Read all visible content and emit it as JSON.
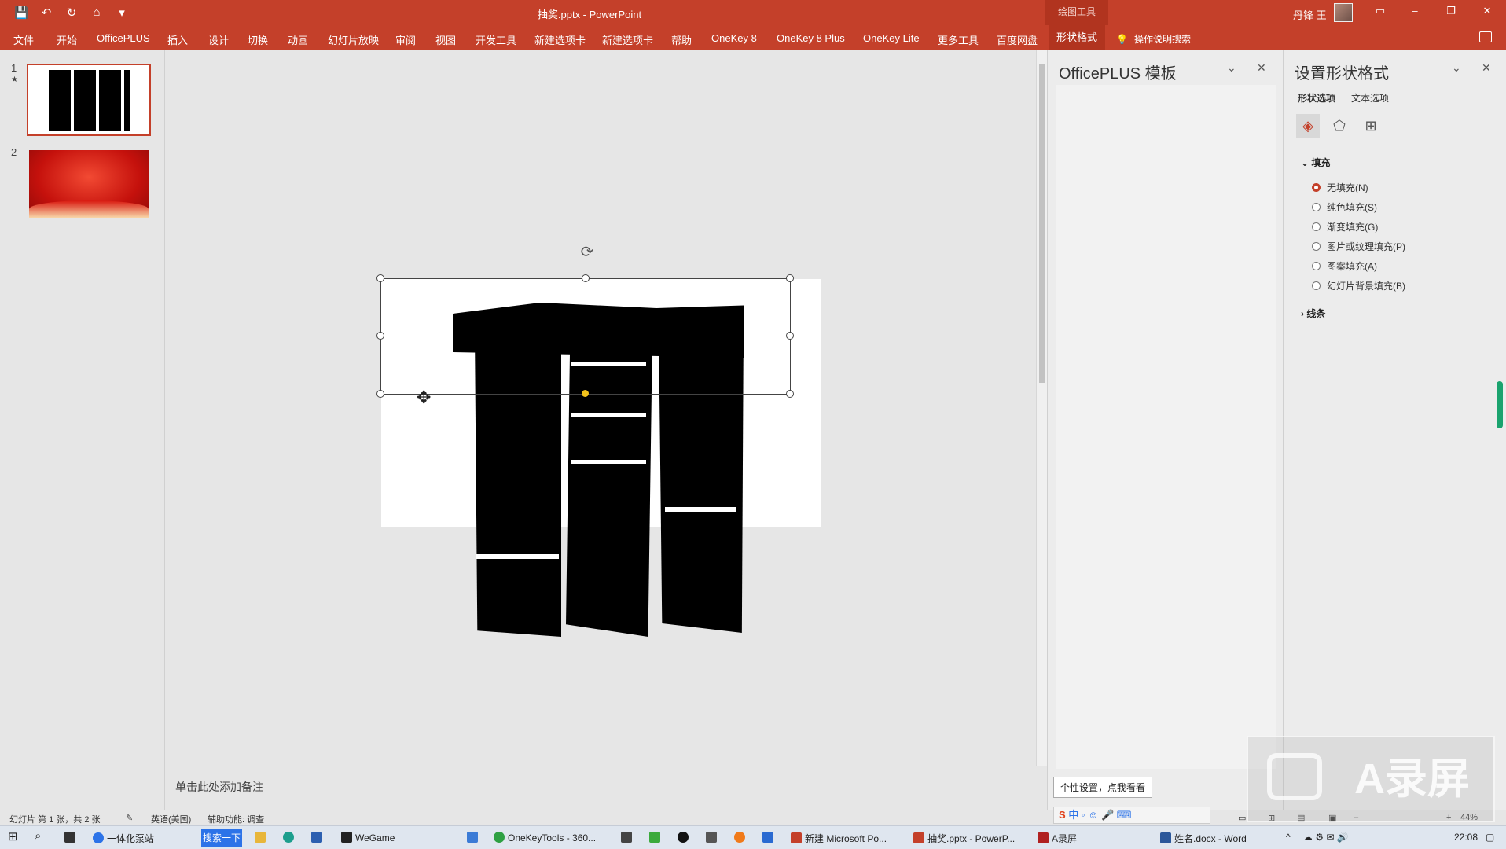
{
  "window": {
    "title": "抽奖.pptx  -  PowerPoint",
    "tools_context": "绘图工具",
    "user_name": "丹锋 王"
  },
  "ribbon": {
    "tabs": [
      "文件",
      "开始",
      "OfficePLUS",
      "插入",
      "设计",
      "切换",
      "动画",
      "幻灯片放映",
      "审阅",
      "视图",
      "开发工具",
      "新建选项卡",
      "新建选项卡",
      "帮助",
      "OneKey 8",
      "OneKey 8 Plus",
      "OneKey Lite",
      "更多工具",
      "百度网盘",
      "形状格式"
    ],
    "active_tab": "形状格式",
    "help_search": "操作说明搜索"
  },
  "thumbnails": {
    "items": [
      {
        "number": "1",
        "star": "★"
      },
      {
        "number": "2",
        "star": ""
      }
    ]
  },
  "notes": {
    "placeholder": "单击此处添加备注"
  },
  "plus_pane": {
    "title": "OfficePLUS 模板",
    "tip": "个性设置，点我看看"
  },
  "format_pane": {
    "title": "设置形状格式",
    "subtabs": [
      "形状选项",
      "文本选项"
    ],
    "fill_section": "填充",
    "fill_options": [
      "无填充(N)",
      "纯色填充(S)",
      "渐变填充(G)",
      "图片或纹理填充(P)",
      "图案填充(A)",
      "幻灯片背景填充(B)"
    ],
    "selected_fill": "无填充(N)",
    "line_section": "线条"
  },
  "status": {
    "slide_info": "幻灯片 第 1 张，共 2 张",
    "language": "英语(美国)",
    "accessibility": "辅助功能: 调查",
    "zoom": "44%"
  },
  "taskbar": {
    "search_text": "一体化泵站",
    "search_button": "搜索一下",
    "items": [
      "WeGame",
      "OneKeyTools - 360...",
      "新建 Microsoft Po...",
      "抽奖.pptx - PowerP...",
      "A录屏",
      "姓名.docx - Word"
    ],
    "time": "22:08"
  },
  "watermark": {
    "text": "A录屏"
  },
  "colors": {
    "accent": "#c4402a",
    "ribbon": "#c4402a"
  }
}
